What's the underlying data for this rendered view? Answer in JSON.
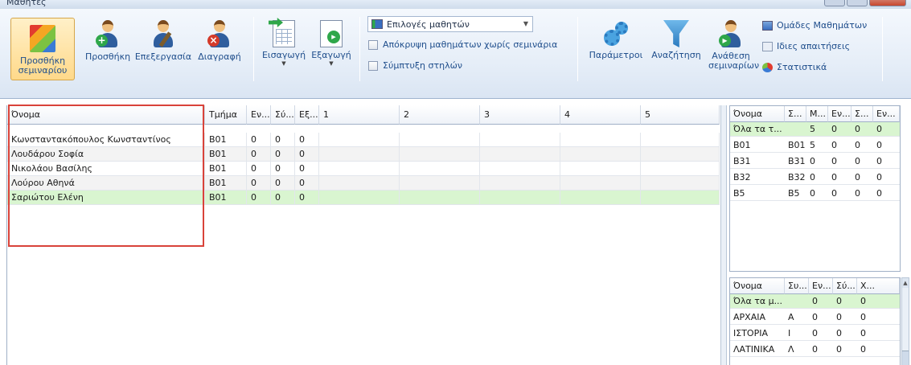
{
  "window": {
    "title": "Μαθητές"
  },
  "ribbon": {
    "add_seminar": "Προσθήκη σεμιναρίου",
    "add": "Προσθήκη",
    "edit": "Επεξεργασία",
    "delete": "Διαγραφή",
    "import": "Εισαγωγή",
    "export": "Εξαγωγή",
    "student_options": "Επιλογές μαθητών",
    "hide_no_seminar": "Απόκρυψη μαθημάτων χωρίς σεμινάρια",
    "collapse_columns": "Σύμπτυξη στηλών",
    "parameters": "Παράμετροι",
    "search": "Αναζήτηση",
    "assign_seminars": "Ανάθεση σεμιναρίων",
    "course_groups": "Ομάδες Μαθημάτων",
    "special_requirements": "Ιδιες απαιτήσεις",
    "statistics": "Στατιστικά"
  },
  "main_grid": {
    "columns": [
      "Όνομα",
      "Τμήμα",
      "Εν...",
      "Σύ...",
      "Εξ...",
      "1",
      "2",
      "3",
      "4",
      "5"
    ],
    "rows": [
      {
        "name": "Κωνσταντακόπουλος Κωνσταντίνος",
        "dept": "B01",
        "c1": "0",
        "c2": "0",
        "c3": "0"
      },
      {
        "name": "Λουδάρου Σοφία",
        "dept": "B01",
        "c1": "0",
        "c2": "0",
        "c3": "0"
      },
      {
        "name": "Νικολάου Βασίλης",
        "dept": "B01",
        "c1": "0",
        "c2": "0",
        "c3": "0"
      },
      {
        "name": "Λούρου Αθηνά",
        "dept": "B01",
        "c1": "0",
        "c2": "0",
        "c3": "0"
      },
      {
        "name": "Σαριώτου Ελένη",
        "dept": "B01",
        "c1": "0",
        "c2": "0",
        "c3": "0"
      }
    ]
  },
  "dept_panel": {
    "columns": [
      "Όνομα",
      "Σ...",
      "Μ...",
      "Εν...",
      "Σ...",
      "Εν..."
    ],
    "rows": [
      {
        "c0": "Όλα τα τ...",
        "c1": "",
        "c2": "5",
        "c3": "0",
        "c4": "0",
        "c5": "0"
      },
      {
        "c0": "B01",
        "c1": "B01",
        "c2": "5",
        "c3": "0",
        "c4": "0",
        "c5": "0"
      },
      {
        "c0": "B31",
        "c1": "B31",
        "c2": "0",
        "c3": "0",
        "c4": "0",
        "c5": "0"
      },
      {
        "c0": "B32",
        "c1": "B32",
        "c2": "0",
        "c3": "0",
        "c4": "0",
        "c5": "0"
      },
      {
        "c0": "B5",
        "c1": "B5",
        "c2": "0",
        "c3": "0",
        "c4": "0",
        "c5": "0"
      }
    ]
  },
  "course_panel": {
    "columns": [
      "Όνομα",
      "Συ...",
      "Εν...",
      "Σύ...",
      "Χ..."
    ],
    "rows": [
      {
        "c0": "Όλα τα μ...",
        "c1": "",
        "c2": "0",
        "c3": "0",
        "c4": "0"
      },
      {
        "c0": "ΑΡΧΑΙΑ",
        "c1": "Α",
        "c2": "0",
        "c3": "0",
        "c4": "0"
      },
      {
        "c0": "ΙΣΤΟΡΙΑ",
        "c1": "Ι",
        "c2": "0",
        "c3": "0",
        "c4": "0"
      },
      {
        "c0": "ΛΑΤΙΝΙΚΑ",
        "c1": "Λ",
        "c2": "0",
        "c3": "0",
        "c4": "0"
      }
    ]
  },
  "colors": {
    "selected_row": "#d9f5d0",
    "highlight_frame": "#d9433a",
    "ribbon_label": "#1f4e8c"
  }
}
